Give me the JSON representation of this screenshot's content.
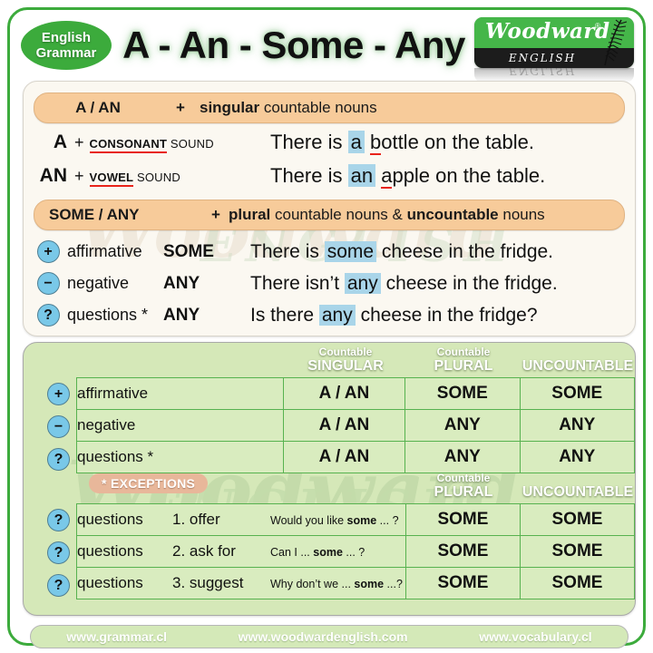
{
  "header": {
    "badge_line1": "English",
    "badge_line2": "Grammar",
    "title": "A - An - Some - Any",
    "logo_word": "Woodward",
    "logo_reg": "®",
    "logo_sub": "ENGLISH",
    "logo_reflection": "ENGLISH"
  },
  "section_a_an": {
    "bar_label": "A / AN",
    "bar_plus": "+",
    "bar_desc_bold": "singular",
    "bar_desc_rest": " countable nouns",
    "rows": [
      {
        "article": "A",
        "plus": "+",
        "sound_underlined": "CONSONANT",
        "sound_rest": " SOUND",
        "sentence_pre": "There is ",
        "highlight": "a",
        "sentence_mid_red": "b",
        "sentence_post": "ottle on the table."
      },
      {
        "article": "AN",
        "plus": "+",
        "sound_underlined": "VOWEL",
        "sound_rest": " SOUND",
        "sentence_pre": "There is ",
        "highlight": "an",
        "sentence_mid_red": "a",
        "sentence_post": "pple on the table."
      }
    ]
  },
  "section_some_any": {
    "bar_label": "SOME / ANY",
    "bar_plus": "+",
    "bar_desc_bold1": "plural",
    "bar_desc_mid": " countable nouns & ",
    "bar_desc_bold2": "uncountable",
    "bar_desc_end": " nouns",
    "rows": [
      {
        "icon": "plus-icon",
        "icon_glyph": "+",
        "type": "affirmative",
        "word": "SOME",
        "sentence_pre": "There is ",
        "highlight": "some",
        "sentence_post": " cheese in the fridge."
      },
      {
        "icon": "minus-icon",
        "icon_glyph": "−",
        "type": "negative",
        "word": "ANY",
        "sentence_pre": "There isn’t ",
        "highlight": "any",
        "sentence_post": " cheese in the fridge."
      },
      {
        "icon": "question-icon",
        "icon_glyph": "?",
        "type": "questions *",
        "word": "ANY",
        "sentence_pre": "Is there ",
        "highlight": "any",
        "sentence_post": " cheese in the fridge?"
      }
    ]
  },
  "table": {
    "columns": [
      {
        "sub": "Countable",
        "main": "SINGULAR"
      },
      {
        "sub": "Countable",
        "main": "PLURAL"
      },
      {
        "sub": "",
        "main": "UNCOUNTABLE"
      }
    ],
    "rows": [
      {
        "icon_glyph": "+",
        "icon": "plus-icon",
        "label": "affirmative",
        "singular": "A / AN",
        "plural": "SOME",
        "uncountable": "SOME"
      },
      {
        "icon_glyph": "−",
        "icon": "minus-icon",
        "label": "negative",
        "singular": "A / AN",
        "plural": "ANY",
        "uncountable": "ANY"
      },
      {
        "icon_glyph": "?",
        "icon": "question-icon",
        "label": "questions *",
        "singular": "A / AN",
        "plural": "ANY",
        "uncountable": "ANY"
      }
    ]
  },
  "exceptions": {
    "badge": "* EXCEPTIONS",
    "columns": [
      {
        "sub": "Countable",
        "main": "PLURAL"
      },
      {
        "sub": "",
        "main": "UNCOUNTABLE"
      }
    ],
    "rows": [
      {
        "icon_glyph": "?",
        "icon": "question-icon",
        "label": "questions",
        "number": "1. offer",
        "example_pre": "Would you like ",
        "example_bold": "some",
        "example_post": " ... ?",
        "plural": "SOME",
        "uncountable": "SOME"
      },
      {
        "icon_glyph": "?",
        "icon": "question-icon",
        "label": "questions",
        "number": "2. ask for",
        "example_pre": "Can I ... ",
        "example_bold": "some",
        "example_post": " ... ?",
        "plural": "SOME",
        "uncountable": "SOME"
      },
      {
        "icon_glyph": "?",
        "icon": "question-icon",
        "label": "questions",
        "number": "3. suggest",
        "example_pre": "Why don’t we ... ",
        "example_bold": "some",
        "example_post": " ...?",
        "plural": "SOME",
        "uncountable": "SOME"
      }
    ]
  },
  "footer": {
    "links": [
      "www.grammar.cl",
      "www.woodwardenglish.com",
      "www.vocabulary.cl"
    ]
  },
  "watermarks": {
    "word": "Woodward",
    "english": "ENGLISH"
  },
  "colors": {
    "green": "#3cab3c",
    "orange_bar": "#f7cb9a",
    "highlight_blue": "#a9d5e9",
    "table_cell": "#d9ecbf",
    "table_border": "#57b24f",
    "panel_green": "#d5e8b8",
    "red_underline": "#e8231a",
    "icon_blue": "#79c8e8",
    "exception_badge": "#e8b79a"
  }
}
